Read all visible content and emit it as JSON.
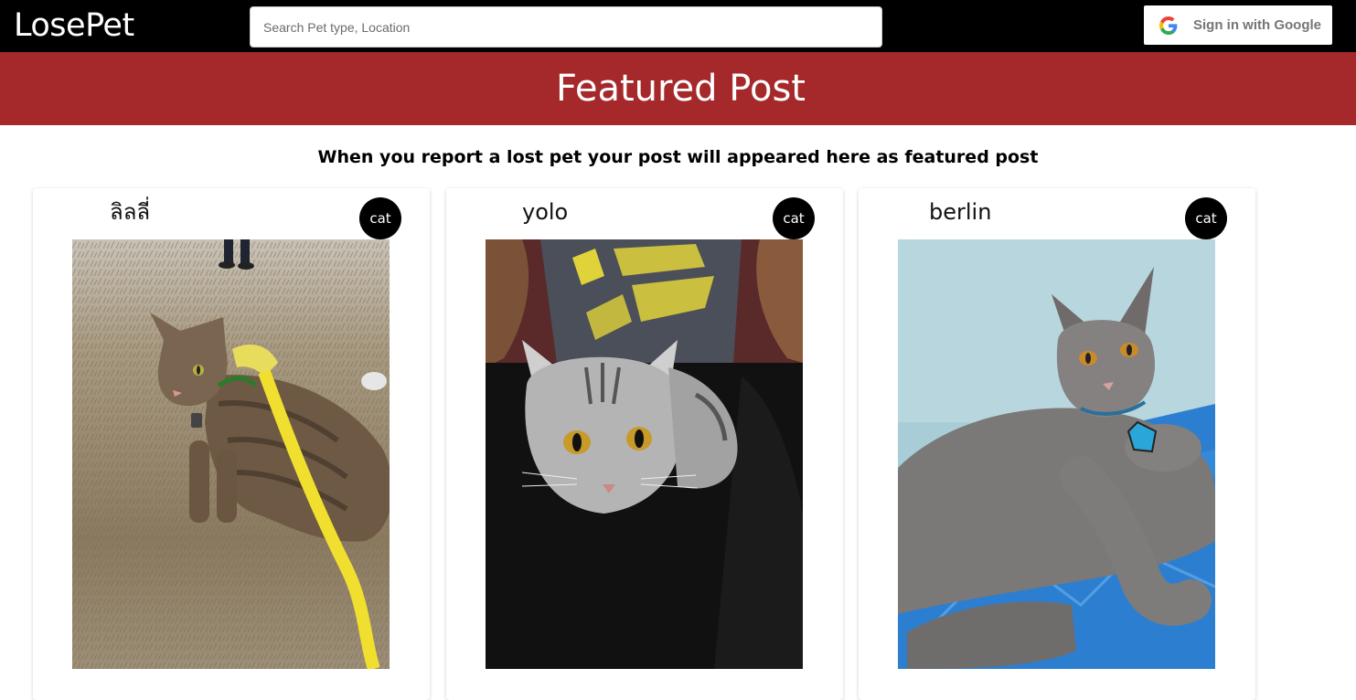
{
  "header": {
    "logo": "LosePet",
    "search_placeholder": "Search Pet type, Location",
    "signin_label": "Sign in with Google",
    "signin_icon": "google-g-icon"
  },
  "banner": {
    "title": "Featured Post"
  },
  "subtitle": "When you report a lost pet your post will appeared here as featured post",
  "posts": [
    {
      "name": "ลิลลี่",
      "type": "cat",
      "photo": "tabby cat with yellow harness on dry grass"
    },
    {
      "name": "yolo",
      "type": "cat",
      "photo": "silver tabby cat on lap"
    },
    {
      "name": "berlin",
      "type": "cat",
      "photo": "grey cat lying on blue mat"
    }
  ],
  "colors": {
    "topbar": "#000000",
    "banner": "#a5282a",
    "badge": "#000000"
  }
}
